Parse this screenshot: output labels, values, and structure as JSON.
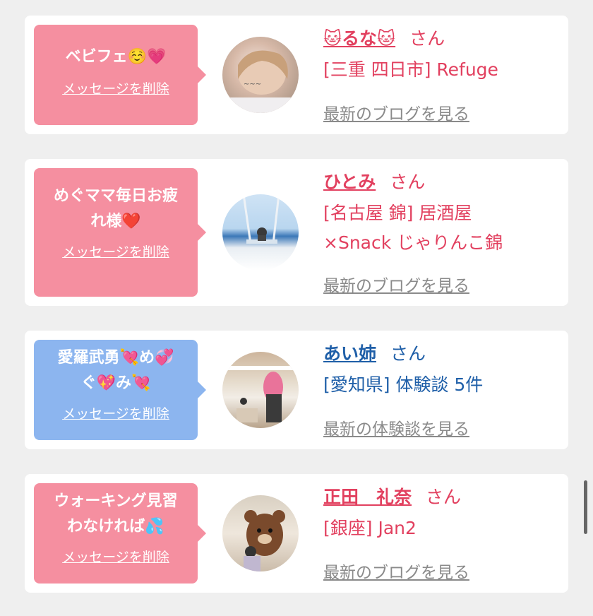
{
  "cards": [
    {
      "message": "ベビフェ☺️💗",
      "delete_label": "メッセージを削除",
      "name": "🐱るな🐱",
      "san": "さん",
      "shop": "[三重 四日市] Refuge",
      "blog_label": "最新のブログを見る",
      "accent": "#e2405f",
      "bubble_color": "#f58fa0"
    },
    {
      "message": "めぐママ毎日お疲\nれ様❤️",
      "delete_label": "メッセージを削除",
      "name": "ひとみ",
      "san": "さん",
      "shop": "[名古屋 錦] 居酒屋\n×Snack じゃりんこ錦",
      "blog_label": "最新のブログを見る",
      "accent": "#e2405f",
      "bubble_color": "#f58fa0"
    },
    {
      "message": "愛羅武勇💘め💞\nぐ💖み💘",
      "delete_label": "メッセージを削除",
      "name": "あい姉",
      "san": "さん",
      "shop": "[愛知県] 体験談 5件",
      "blog_label": "最新の体験談を見る",
      "accent": "#1f5fa8",
      "bubble_color": "#8cb5ef"
    },
    {
      "message": "ウォーキング見習\nわなければ💦",
      "delete_label": "メッセージを削除",
      "name": "正田　礼奈",
      "san": "さん",
      "shop": "[銀座] Jan2",
      "blog_label": "最新のブログを見る",
      "accent": "#e2405f",
      "bubble_color": "#f58fa0"
    }
  ]
}
